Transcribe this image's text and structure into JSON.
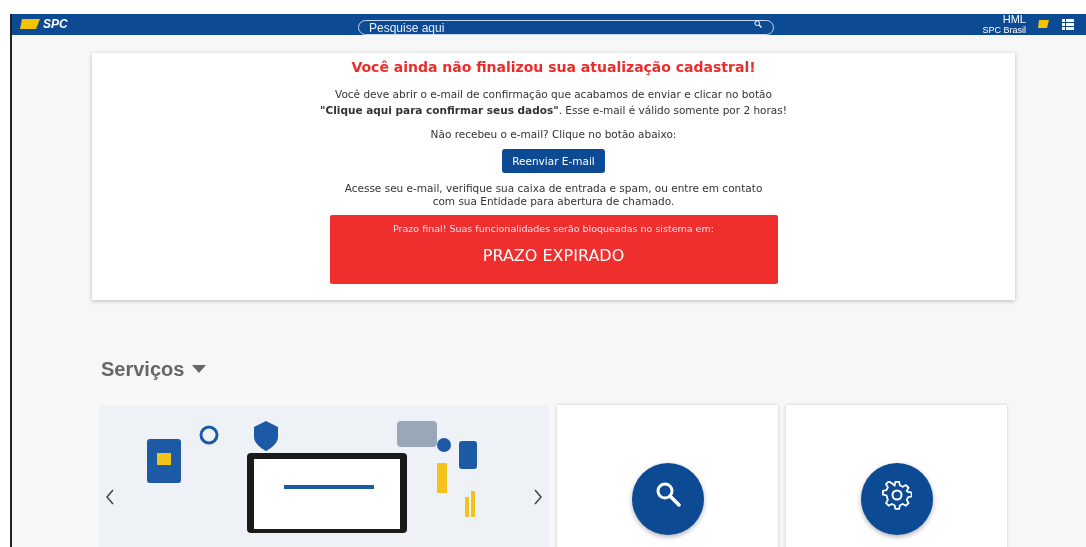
{
  "header": {
    "logo_text": "SPC",
    "search": {
      "placeholder": "Pesquise aqui"
    },
    "environment": "HML",
    "organization": "SPC Brasil"
  },
  "alert": {
    "title": "Você ainda não finalizou sua atualização cadastral!",
    "message": "Você deve abrir o e-mail de confirmação que acabamos de enviar e clicar no botão **\"Clique aqui para confirmar seus dados\"**. Esse e-mail é válido somente por 2 horas!",
    "prompt": "Não recebeu o e-mail? Clique no botão abaixo:",
    "button": "Reenviar E-mail",
    "help": "Acesse seu e-mail, verifique sua caixa de entrada e spam, ou entre em contato com sua Entidade para abertura de chamado.",
    "deadline": {
      "label": "Prazo final! Suas funcionalidades serão bloqueadas no sistema em:",
      "value": "PRAZO EXPIRADO"
    }
  },
  "services": {
    "title": "Serviços",
    "cards": [
      {
        "kind": "carousel"
      },
      {
        "kind": "search"
      },
      {
        "kind": "settings"
      }
    ]
  }
}
